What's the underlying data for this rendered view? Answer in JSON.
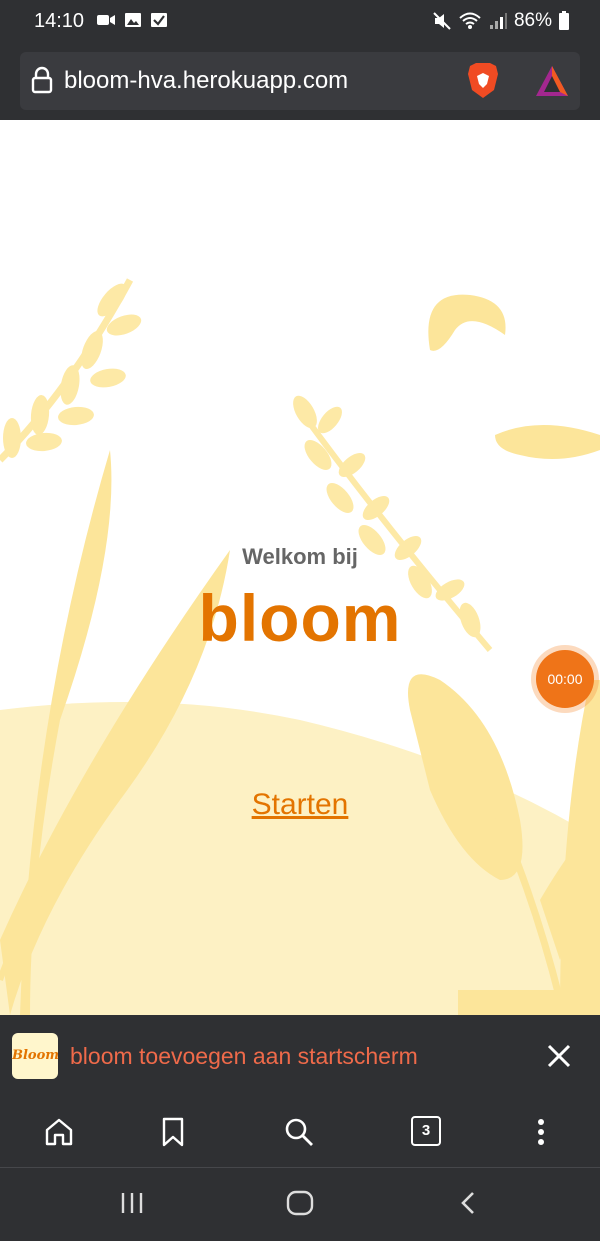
{
  "status_bar": {
    "time": "14:10",
    "battery": "86%"
  },
  "browser": {
    "url": "bloom-hva.herokuapp.com",
    "tab_count": "3"
  },
  "page": {
    "welcome": "Welkom bij",
    "logo": "bloom",
    "start_link": "Starten",
    "timer": "00:00"
  },
  "add_to_home": {
    "icon_text": "Bloom",
    "message": "bloom toevoegen aan startscherm"
  },
  "colors": {
    "accent": "#e37400",
    "leaf": "#fce59a",
    "leaf_pale": "#fdf1c4",
    "bar": "#2f3033",
    "banner_text": "#ef6a4a"
  },
  "icons": {
    "status_left": [
      "video-icon",
      "image-icon",
      "check-icon"
    ],
    "status_right": [
      "mute-icon",
      "wifi-icon",
      "signal-icon",
      "battery-icon"
    ]
  }
}
